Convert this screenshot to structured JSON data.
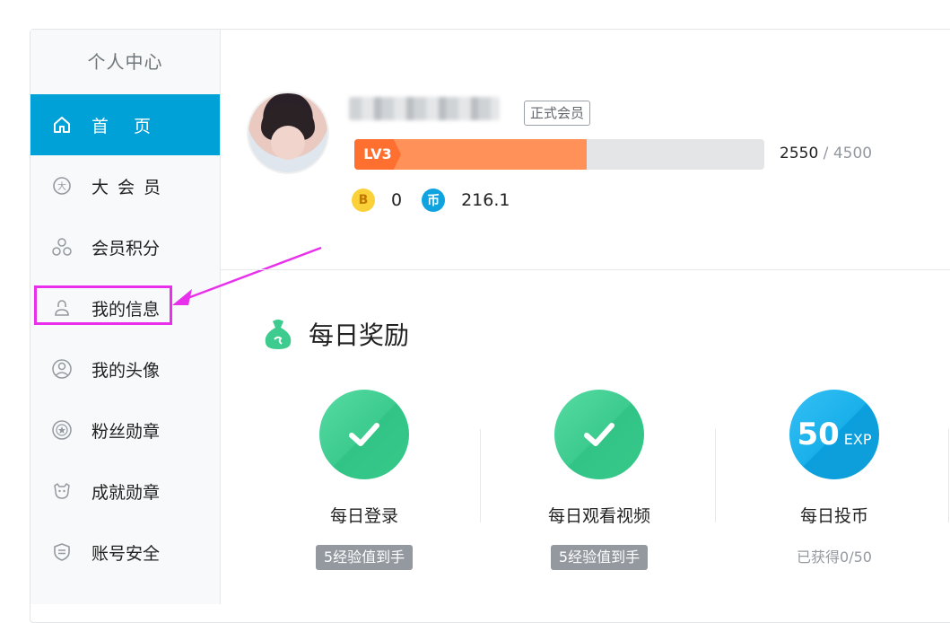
{
  "sidebar": {
    "title": "个人中心",
    "items": [
      {
        "label": "首页",
        "icon": "home-icon",
        "active": true
      },
      {
        "label": "大会员",
        "icon": "vip-icon"
      },
      {
        "label": "会员积分",
        "icon": "points-icon"
      },
      {
        "label": "我的信息",
        "icon": "user-icon"
      },
      {
        "label": "我的头像",
        "icon": "avatar-icon"
      },
      {
        "label": "粉丝勋章",
        "icon": "fan-medal-icon"
      },
      {
        "label": "成就勋章",
        "icon": "achievement-icon"
      },
      {
        "label": "账号安全",
        "icon": "shield-icon"
      }
    ]
  },
  "profile": {
    "member_badge": "正式会员",
    "level": "LV3",
    "exp_current": "2550",
    "exp_sep": "/",
    "exp_max": "4500",
    "level_progress": 0.5667,
    "b_coin_symbol": "B",
    "b_coin_value": "0",
    "coin_symbol": "币",
    "coin_value": "216.1"
  },
  "daily": {
    "title": "每日奖励",
    "rewards": [
      {
        "name": "每日登录",
        "tag": "5经验值到手",
        "status": "done"
      },
      {
        "name": "每日观看视频",
        "tag": "5经验值到手",
        "status": "done"
      },
      {
        "name": "每日投币",
        "progress": "已获得0/50",
        "badge_num": "50",
        "badge_unit": "EXP",
        "status": "pending"
      }
    ]
  },
  "colors": {
    "accent": "#00a1d6",
    "level_fill": "#ff9159",
    "done_green": "#3dcb8f",
    "highlight": "#e830ec"
  }
}
